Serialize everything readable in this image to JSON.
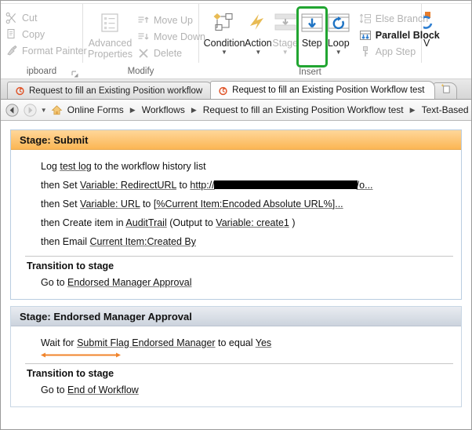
{
  "ribbon": {
    "groups": [
      {
        "name": "clipboard",
        "label": "ipboard",
        "items": [
          {
            "label": "Cut",
            "icon": "scissors-icon",
            "disabled": true
          },
          {
            "label": "Copy",
            "icon": "copy-icon",
            "disabled": true
          },
          {
            "label": "Format Painter",
            "icon": "format-painter-icon",
            "disabled": true
          }
        ]
      },
      {
        "name": "modify",
        "label": "Modify",
        "advanced": {
          "line1": "Advanced",
          "line2": "Properties",
          "icon": "properties-icon",
          "disabled": true
        },
        "items": [
          {
            "label": "Move Up",
            "icon": "move-up-icon",
            "disabled": true
          },
          {
            "label": "Move Down",
            "icon": "move-down-icon",
            "disabled": true
          },
          {
            "label": "Delete",
            "icon": "delete-icon",
            "disabled": true
          }
        ]
      },
      {
        "name": "insert",
        "label": "Insert",
        "big": [
          {
            "label": "Condition",
            "icon": "condition-icon",
            "disabled": false,
            "caret": true,
            "highlighted": false
          },
          {
            "label": "Action",
            "icon": "action-icon",
            "disabled": false,
            "caret": true,
            "highlighted": false
          },
          {
            "label": "Stage",
            "icon": "stage-icon",
            "disabled": true,
            "caret": true,
            "highlighted": false
          },
          {
            "label": "Step",
            "icon": "step-icon",
            "disabled": false,
            "caret": false,
            "highlighted": true
          },
          {
            "label": "Loop",
            "icon": "loop-icon",
            "disabled": false,
            "caret": true,
            "highlighted": false
          }
        ],
        "small": [
          {
            "label": "Else Branch",
            "icon": "else-branch-icon",
            "disabled": true
          },
          {
            "label": "Parallel Block",
            "icon": "parallel-block-icon",
            "disabled": false
          },
          {
            "label": "App Step",
            "icon": "app-step-icon",
            "disabled": true
          }
        ]
      },
      {
        "name": "manage",
        "label": "",
        "clipped": [
          {
            "label": "V",
            "icon": "variables-icon",
            "disabled": false
          }
        ]
      }
    ],
    "accent_green": "#21a531",
    "accent_blue": "#1f74c4",
    "accent_gold": "#e8bb54"
  },
  "tabs": {
    "items": [
      {
        "label": "Request to fill an Existing Position workflow",
        "icon": "workflow-icon",
        "active": false
      },
      {
        "label": "Request to fill an Existing Position Workflow test",
        "icon": "workflow-icon",
        "active": true
      }
    ],
    "new_tab_icon": "new-tab-icon"
  },
  "breadcrumb": {
    "back_icon": "back-arrow-icon",
    "forward_icon": "forward-arrow-icon",
    "dropdown_icon": "chevron-down-icon",
    "home_icon": "home-icon",
    "separator": "▶",
    "crumbs": [
      "Online Forms",
      "Workflows",
      "Request to fill an Existing Position Workflow test",
      "Text-Based Des"
    ]
  },
  "canvas": {
    "stages": [
      {
        "header": "Stage: Submit",
        "selected": true,
        "lines": [
          {
            "parts": [
              {
                "t": "Log ",
                "link": false
              },
              {
                "t": "test log",
                "link": true
              },
              {
                "t": " to the workflow history list",
                "link": false
              }
            ]
          },
          {
            "parts": [
              {
                "t": "then Set ",
                "link": false
              },
              {
                "t": "Variable: RedirectURL",
                "link": true
              },
              {
                "t": " to ",
                "link": false
              },
              {
                "t": "http://",
                "link": true
              },
              {
                "t": "",
                "redacted": true
              },
              {
                "t": "/o...",
                "link": true
              }
            ]
          },
          {
            "parts": [
              {
                "t": "then Set ",
                "link": false
              },
              {
                "t": "Variable: URL",
                "link": true
              },
              {
                "t": " to ",
                "link": false
              },
              {
                "t": "[%Current Item:Encoded Absolute URL%]...",
                "link": true
              }
            ]
          },
          {
            "parts": [
              {
                "t": "then Create item in ",
                "link": false
              },
              {
                "t": "AuditTrail",
                "link": true
              },
              {
                "t": " (Output to ",
                "link": false
              },
              {
                "t": "Variable: create1",
                "link": true
              },
              {
                "t": " )",
                "link": false
              }
            ]
          },
          {
            "parts": [
              {
                "t": "then Email ",
                "link": false
              },
              {
                "t": "Current Item:Created By",
                "link": true
              }
            ]
          }
        ],
        "caret_after_line": -1,
        "transition_label": "Transition to stage",
        "transition": {
          "parts": [
            {
              "t": "Go to ",
              "link": false
            },
            {
              "t": "Endorsed Manager Approval",
              "link": true
            }
          ]
        }
      },
      {
        "header": "Stage: Endorsed Manager Approval",
        "selected": false,
        "lines": [
          {
            "parts": [
              {
                "t": "Wait for ",
                "link": false
              },
              {
                "t": "Submit Flag Endorsed Manager",
                "link": true
              },
              {
                "t": " to equal ",
                "link": false
              },
              {
                "t": "Yes",
                "link": true
              }
            ]
          }
        ],
        "caret_after_line": 0,
        "transition_label": "Transition to stage",
        "transition": {
          "parts": [
            {
              "t": "Go to ",
              "link": false
            },
            {
              "t": "End of Workflow",
              "link": true
            }
          ]
        }
      }
    ],
    "insertion_caret_color": "#f0842c"
  }
}
